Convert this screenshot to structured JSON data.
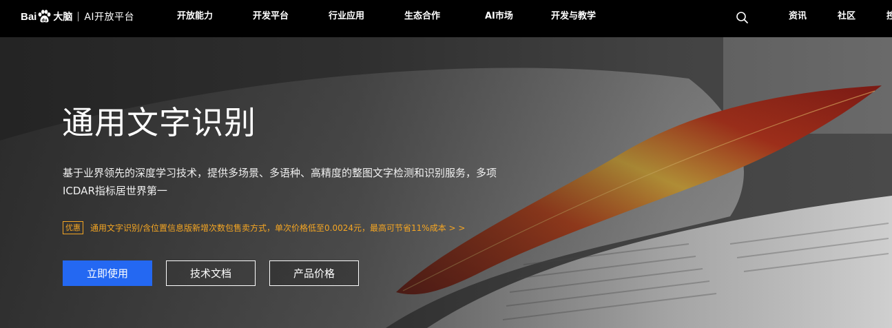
{
  "header": {
    "logo": {
      "brand_left": "Bai",
      "brand_right": "大脑",
      "product": "AI开放平台"
    },
    "nav": [
      "开放能力",
      "开发平台",
      "行业应用",
      "生态合作",
      "AI市场",
      "开发与教学"
    ],
    "right_links": [
      "资讯",
      "社区",
      "控"
    ],
    "search_icon": "search-icon"
  },
  "hero": {
    "title": "通用文字识别",
    "description": "基于业界领先的深度学习技术，提供多场景、多语种、高精度的整图文字检测和识别服务，多项ICDAR指标居世界第一",
    "promo": {
      "tag": "优惠",
      "text": "通用文字识别/含位置信息版新增次数包售卖方式，单次价格低至0.0024元，最高可节省11%成本 > >"
    },
    "buttons": {
      "primary": "立即使用",
      "docs": "技术文档",
      "pricing": "产品价格"
    }
  },
  "colors": {
    "nav_bg": "#000000",
    "primary_button": "#2468f2",
    "promo": "#f5a623"
  }
}
